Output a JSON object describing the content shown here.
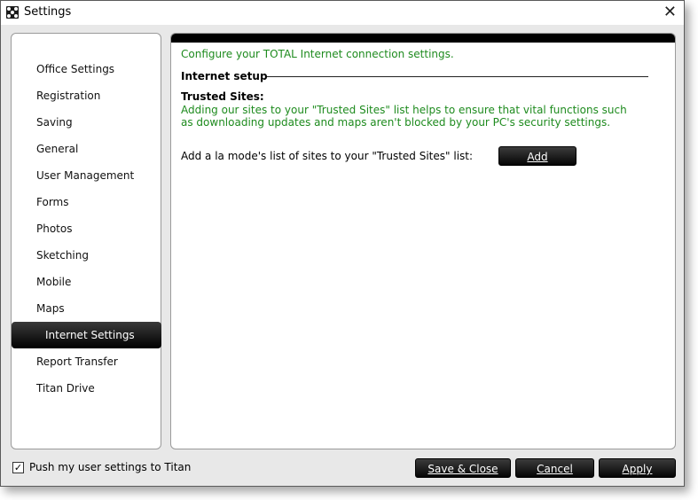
{
  "window": {
    "title": "Settings",
    "close_glyph": "✕"
  },
  "sidebar": {
    "items": [
      {
        "label": "Office Settings"
      },
      {
        "label": "Registration"
      },
      {
        "label": "Saving"
      },
      {
        "label": "General"
      },
      {
        "label": "User Management"
      },
      {
        "label": "Forms"
      },
      {
        "label": "Photos"
      },
      {
        "label": "Sketching"
      },
      {
        "label": "Mobile"
      },
      {
        "label": "Maps"
      },
      {
        "label": "Internet Settings",
        "active": true
      },
      {
        "label": "Report Transfer"
      },
      {
        "label": "Titan Drive"
      }
    ]
  },
  "content": {
    "headline": "Configure your TOTAL Internet connection settings.",
    "section_title": "Internet setup",
    "trusted_title": "Trusted Sites:",
    "trusted_desc": "Adding our sites to your \"Trusted Sites\" list helps to ensure that vital functions such as downloading updates and maps aren't blocked by your PC's security settings.",
    "add_label": "Add a la mode's list of sites to your \"Trusted Sites\" list:",
    "add_button": "Add"
  },
  "footer": {
    "push_label": "Push my user settings to Titan",
    "push_checked": true,
    "check_glyph": "✓",
    "save_close": "Save & Close",
    "cancel": "Cancel",
    "apply": "Apply"
  },
  "colors": {
    "accent_text": "#1e8b1e",
    "button_bg": "#000000"
  }
}
